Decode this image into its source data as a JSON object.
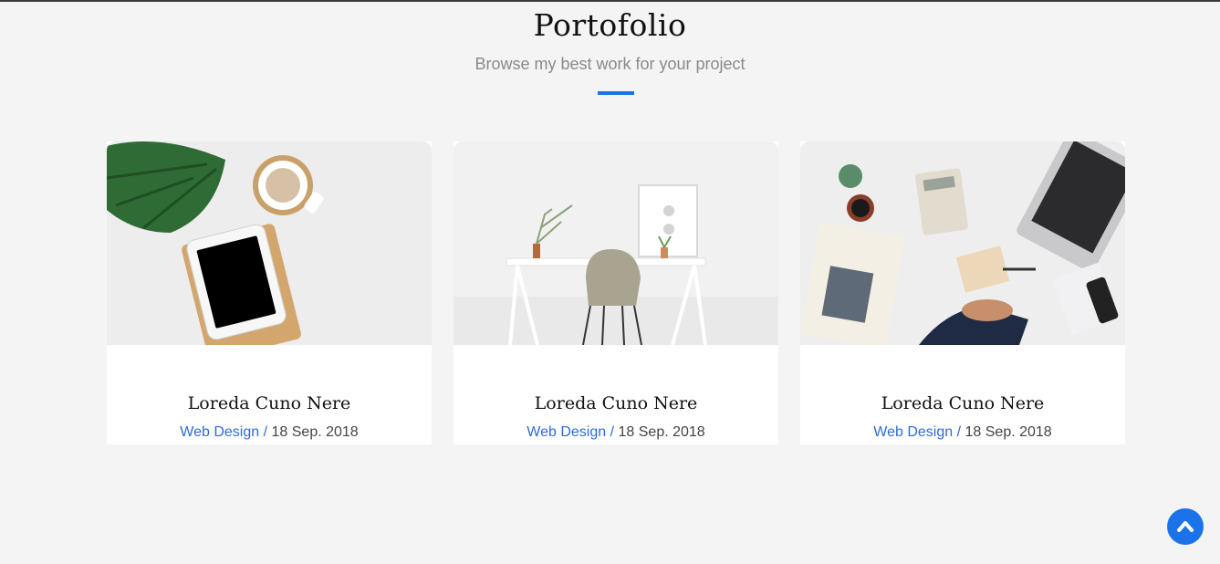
{
  "section": {
    "title": "Portofolio",
    "subtitle": "Browse my best work for your project",
    "accent_color": "#1a73e8"
  },
  "cards": [
    {
      "title": "Loreda Cuno Nere",
      "category": "Web Design",
      "separator": " / ",
      "date": "18 Sep. 2018"
    },
    {
      "title": "Loreda Cuno Nere",
      "category": "Web Design",
      "separator": " / ",
      "date": "18 Sep. 2018"
    },
    {
      "title": "Loreda Cuno Nere",
      "category": "Web Design",
      "separator": " / ",
      "date": "18 Sep. 2018"
    }
  ],
  "back_to_top": {
    "icon": "chevron-up-icon"
  }
}
